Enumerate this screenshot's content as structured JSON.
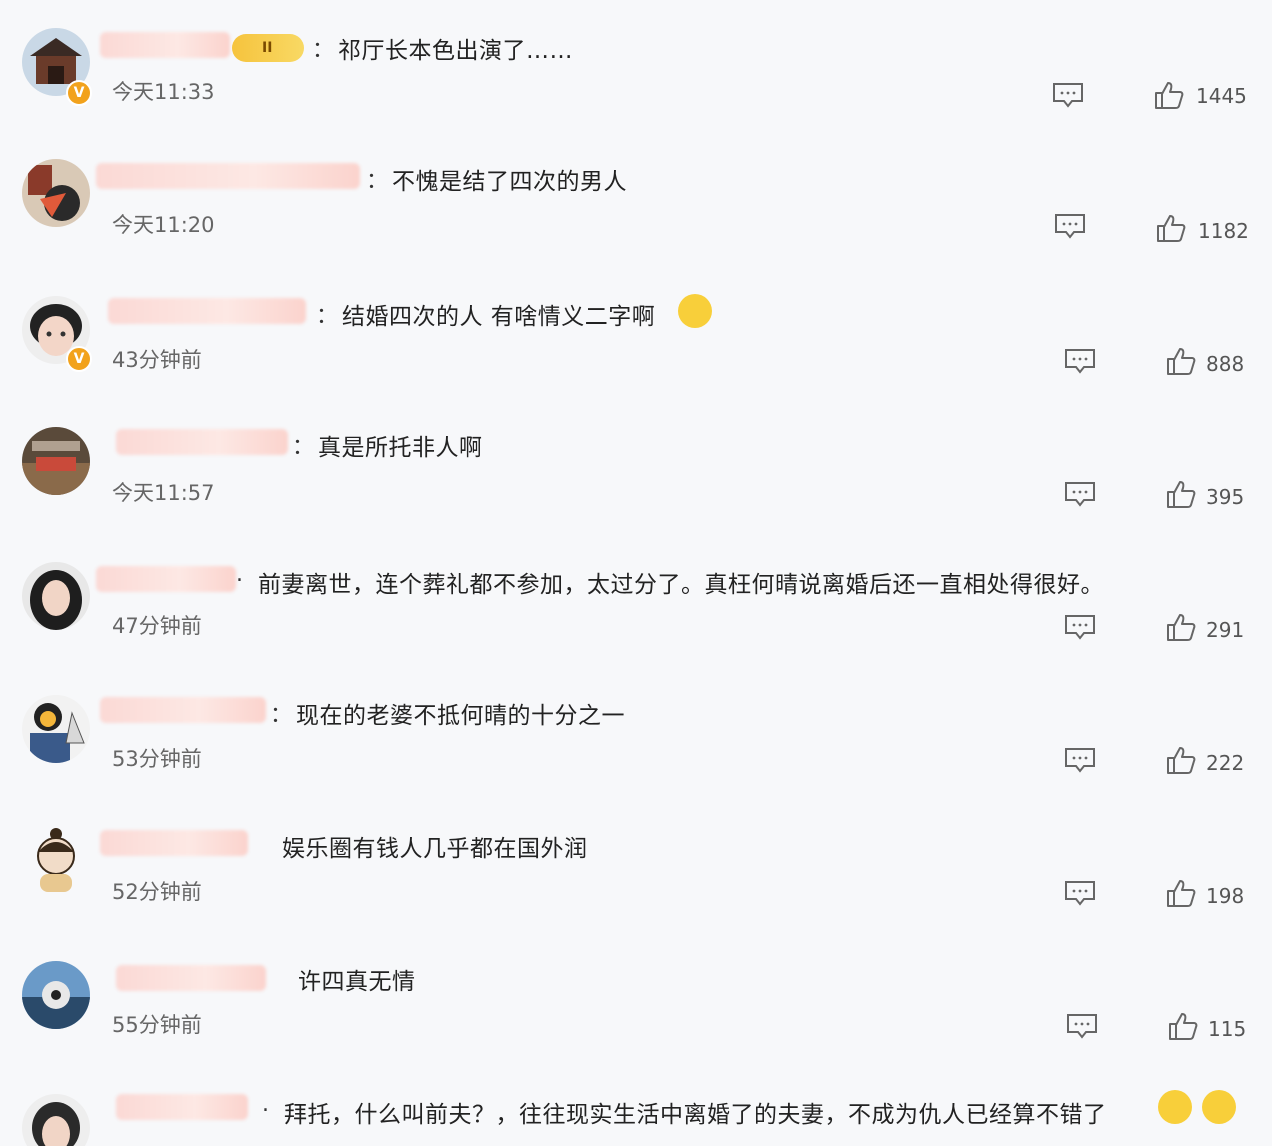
{
  "comments": [
    {
      "text": "祁厅长本色出演了……",
      "time": "今天11:33",
      "likes": "1445"
    },
    {
      "text": "不愧是结了四次的男人",
      "time": "今天11:20",
      "likes": "1182"
    },
    {
      "text": "结婚四次的人 有啥情义二字啊",
      "time": "43分钟前",
      "likes": "888"
    },
    {
      "text": "真是所托非人啊",
      "time": "今天11:57",
      "likes": "395"
    },
    {
      "text": "前妻离世，连个葬礼都不参加，太过分了。真枉何晴说离婚后还一直相处得很好。",
      "time": "47分钟前",
      "likes": "291"
    },
    {
      "text": "现在的老婆不抵何晴的十分之一",
      "time": "53分钟前",
      "likes": "222"
    },
    {
      "text": "娱乐圈有钱人几乎都在国外润",
      "time": "52分钟前",
      "likes": "198"
    },
    {
      "text": "许四真无情",
      "time": "55分钟前",
      "likes": "115"
    },
    {
      "text": "拜托，什么叫前夫？，往往现实生活中离婚了的夫妻，不成为仇人已经算不错了",
      "time": "",
      "likes": ""
    }
  ],
  "colon": "：",
  "level_badge": "II",
  "verified_mark": "V",
  "icons": {
    "reply": "comment-icon",
    "like": "thumbs-up-icon"
  },
  "colors": {
    "badge": "#f2a21c",
    "name_blur": "#fbd9d5"
  }
}
